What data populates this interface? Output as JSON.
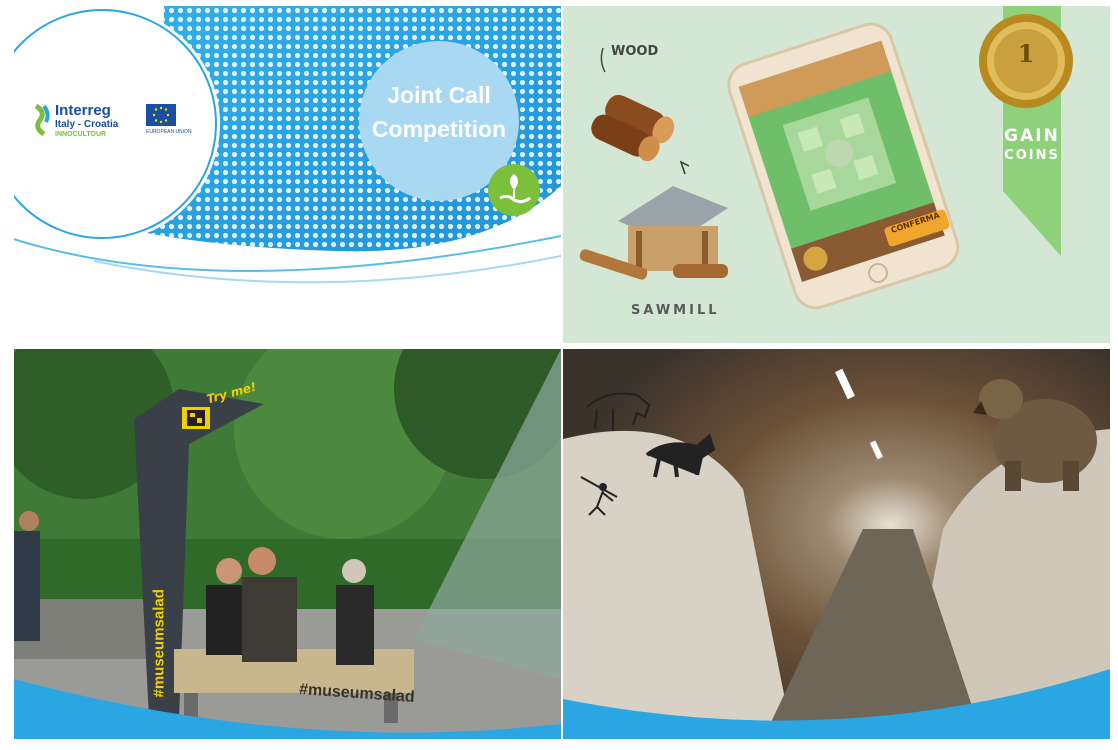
{
  "panel_interreg": {
    "brand": "Interreg",
    "program": "Italy - Croatia",
    "project": "INNOCULTOUR",
    "eu_label": "EUROPEAN UNION",
    "call_title_line1": "Joint Call",
    "call_title_line2": "Competition",
    "colors": {
      "blue": "#2aa6e3",
      "light_blue": "#a9d8f2",
      "green": "#7cbf3a"
    },
    "icon": "plant-hand-icon"
  },
  "panel_game": {
    "wood_label": "WOOD",
    "sawmill_label": "SAWMILL",
    "coin_value": "1",
    "gain_line1": "GAIN",
    "gain_line2": "COINS",
    "confirm_button": "CONFERMA",
    "colors": {
      "background": "#d3e7d4",
      "ribbon": "#8fd07a",
      "coin": "#c9a23b"
    }
  },
  "panel_park": {
    "try_me": "Try me!",
    "hashtag_post": "#museumsalad",
    "hashtag_bench": "#museumsalad"
  },
  "panel_cave": {
    "icons": [
      "bear-icon",
      "cave-painting-icon"
    ]
  }
}
